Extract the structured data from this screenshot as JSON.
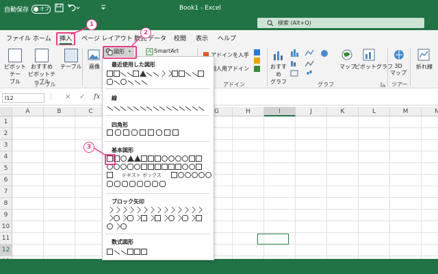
{
  "titlebar": {
    "autosave_label": "自動保存",
    "autosave_state": "オフ",
    "doc_title": "Book1  -  Excel",
    "search_placeholder": "検索 (Alt+Q)"
  },
  "tabs": [
    "ファイル",
    "ホーム",
    "挿入",
    "ページ レイアウト",
    "数式",
    "データ",
    "校閲",
    "表示",
    "ヘルプ"
  ],
  "ribbon": {
    "pivot_table": "ピボットテー\nブル",
    "recommended_pivot": "おすすめ\nピボットテーブル",
    "table": "テーブル",
    "table_group": "テーブル",
    "image": "画像",
    "shapes_button": "図形",
    "smartart": "SmartArt",
    "get_addins": "アドインを入手",
    "my_addins": "個人用アドイン",
    "addins_group": "アドイン",
    "recommended_charts": "おすすめ\nグラフ",
    "map": "マップ",
    "pivot_chart": "ピボットグラフ",
    "graph_group": "グラフ",
    "map3d": "3D\nマップ",
    "tour_group": "ツアー",
    "sparkline_line": "折れ線"
  },
  "formula_bar": {
    "name_box": "I12",
    "cancel": "×",
    "enter": "✓",
    "fx": "fx"
  },
  "grid": {
    "columns": [
      "A",
      "B",
      "C",
      "D",
      "E",
      "F",
      "G",
      "H",
      "I",
      "J",
      "K",
      "L",
      "M",
      "N"
    ],
    "rows": [
      "1",
      "2",
      "3",
      "4",
      "5",
      "6",
      "7",
      "8",
      "9",
      "10",
      "11",
      "12",
      "13"
    ],
    "selected_cell": "I12"
  },
  "dropdown": {
    "recent": "最近使用した図形",
    "lines": "線",
    "rectangles": "四角形",
    "basic": "基本図形",
    "block_arrows": "ブロック矢印",
    "equation": "数式図形",
    "textbox_label": "テキスト ボックス"
  },
  "callouts": [
    "1",
    "2",
    "3"
  ],
  "colors": {
    "excel_green": "#217346",
    "callout_pink": "#e73f8a"
  }
}
